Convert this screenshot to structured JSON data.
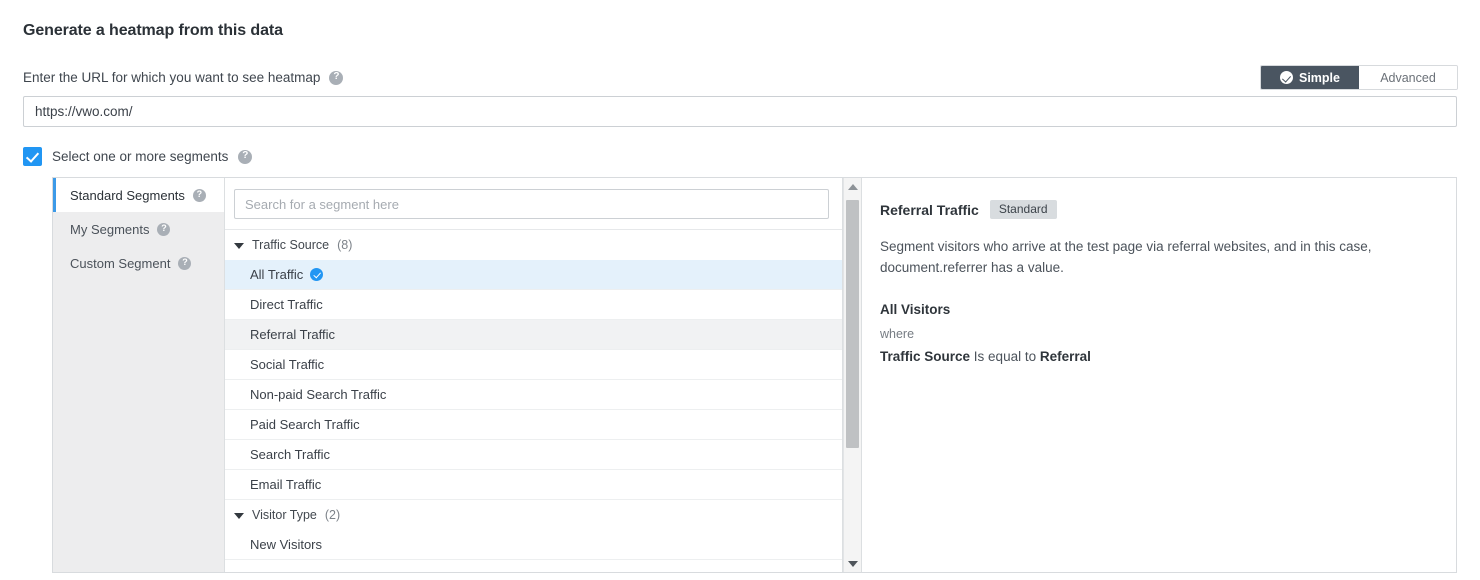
{
  "header": {
    "title": "Generate a heatmap from this data"
  },
  "url_section": {
    "label": "Enter the URL for which you want to see heatmap",
    "help_icon": "help-circle-icon",
    "value": "https://vwo.com/",
    "placeholder": "https://vwo.com/"
  },
  "mode_toggle": {
    "options": [
      {
        "label": "Simple",
        "active": true,
        "icon": "check-circle-icon"
      },
      {
        "label": "Advanced",
        "active": false
      }
    ]
  },
  "segments_checkbox": {
    "checked": true,
    "label": "Select one or more segments",
    "help_icon": "help-circle-icon"
  },
  "segment_tabs": [
    {
      "label": "Standard Segments",
      "active": true,
      "help_icon": "help-circle-icon"
    },
    {
      "label": "My Segments",
      "active": false,
      "help_icon": "help-circle-icon"
    },
    {
      "label": "Custom Segment",
      "active": false,
      "help_icon": "help-circle-icon"
    }
  ],
  "segment_search": {
    "value": "",
    "placeholder": "Search for a segment here"
  },
  "segment_groups": [
    {
      "name": "Traffic Source",
      "count": "(8)",
      "expanded": true,
      "items": [
        {
          "label": "All Traffic",
          "selected": true,
          "hovered": false,
          "check_icon": "check-circle-icon"
        },
        {
          "label": "Direct Traffic",
          "selected": false,
          "hovered": false
        },
        {
          "label": "Referral Traffic",
          "selected": false,
          "hovered": true
        },
        {
          "label": "Social Traffic",
          "selected": false,
          "hovered": false
        },
        {
          "label": "Non-paid Search Traffic",
          "selected": false,
          "hovered": false
        },
        {
          "label": "Paid Search Traffic",
          "selected": false,
          "hovered": false
        },
        {
          "label": "Search Traffic",
          "selected": false,
          "hovered": false
        },
        {
          "label": "Email Traffic",
          "selected": false,
          "hovered": false
        }
      ]
    },
    {
      "name": "Visitor Type",
      "count": "(2)",
      "expanded": true,
      "items": [
        {
          "label": "New Visitors",
          "selected": false,
          "hovered": false
        }
      ]
    }
  ],
  "scrollbar": {
    "up_icon": "chevron-up-icon",
    "down_icon": "chevron-down-icon"
  },
  "segment_detail": {
    "title": "Referral Traffic",
    "badge": "Standard",
    "description": "Segment visitors who arrive at the test page via referral websites, and in this case, document.referrer has a value.",
    "scope": "All Visitors",
    "where_label": "where",
    "rule_attribute": "Traffic Source",
    "rule_operator": "Is equal to",
    "rule_value": "Referral"
  },
  "colors": {
    "accent_blue": "#2196f3",
    "tab_indicator": "#3c9ae8",
    "toggle_active_bg": "#4a5561",
    "selected_row_bg": "#e4f1fb",
    "hover_row_bg": "#f1f2f3",
    "badge_bg": "#d8dcdf",
    "sidebar_bg": "#ededee"
  }
}
